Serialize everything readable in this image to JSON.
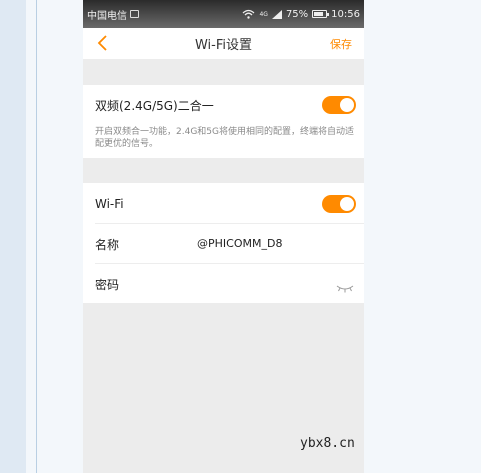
{
  "status_bar": {
    "carrier": "中国电信",
    "network_badge": "4G",
    "battery": "75%",
    "time": "10:56"
  },
  "nav": {
    "title": "Wi-Fi设置",
    "save_label": "保存"
  },
  "dual_band": {
    "label": "双频(2.4G/5G)二合一",
    "enabled": true,
    "description": "开启双频合一功能，2.4G和5G将使用相同的配置，终端将自动适配更优的信号。"
  },
  "wifi": {
    "label": "Wi-Fi",
    "enabled": true,
    "name_label": "名称",
    "name_value": "@PHICOMM_D8",
    "password_label": "密码"
  },
  "watermark": "ybx8.cn",
  "colors": {
    "accent": "#ff8a00"
  },
  "icons": [
    "back-chevron-icon",
    "wifi-icon",
    "signal-icon",
    "battery-icon",
    "eye-closed-icon"
  ]
}
